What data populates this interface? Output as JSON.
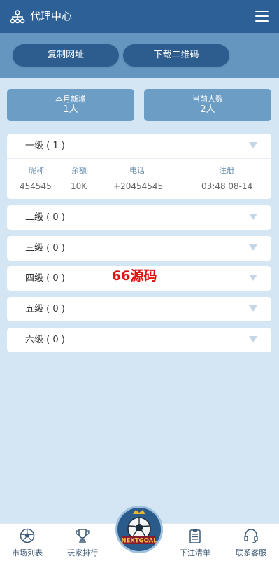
{
  "header": {
    "title": "代理中心",
    "icons": [
      "sitemap-icon",
      "menu-icon"
    ]
  },
  "actions": {
    "copy_label": "复制网址",
    "qr_label": "下载二维码"
  },
  "stats": [
    {
      "label": "本月新增",
      "value": "1人"
    },
    {
      "label": "当前人数",
      "value": "2人"
    }
  ],
  "levels": [
    {
      "name": "一级 ( 1 )"
    },
    {
      "name": "二级 ( 0 )"
    },
    {
      "name": "三级 ( 0 )"
    },
    {
      "name": "四级 ( 0 )"
    },
    {
      "name": "五级 ( 0 )"
    },
    {
      "name": "六级 ( 0 )"
    }
  ],
  "table": {
    "columns": [
      "昵称",
      "余额",
      "电话",
      "注册"
    ],
    "rows": [
      [
        "454545",
        "10K",
        "+20454545",
        "03:48 08-14"
      ]
    ]
  },
  "watermark": "66源码",
  "tabbar": {
    "items": [
      {
        "label": "市场列表",
        "icon": "soccer-ball-icon"
      },
      {
        "label": "玩家排行",
        "icon": "trophy-icon"
      },
      {
        "label": "下注清单",
        "icon": "clipboard-icon"
      },
      {
        "label": "联系客服",
        "icon": "headset-icon"
      }
    ],
    "logo_text": "NEXTGOAL"
  },
  "colors": {
    "header": "#2d6096",
    "actionbar": "#6596c0",
    "pill": "#2d5d8e",
    "background": "#d4e5f3",
    "watermark": "#e01010"
  }
}
